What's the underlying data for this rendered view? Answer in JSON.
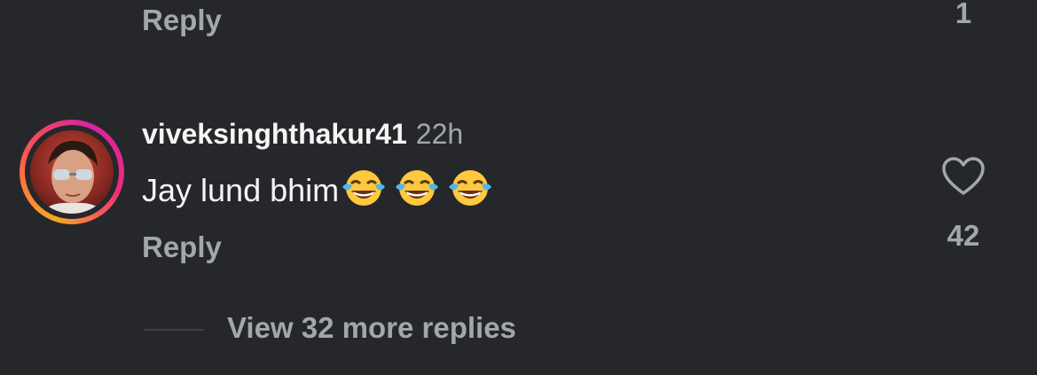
{
  "previous_comment": {
    "reply_label": "Reply",
    "like_count": "1"
  },
  "comment": {
    "username": "viveksinghthakur41",
    "timestamp": "22h",
    "text": "Jay lund bhim",
    "emojis": [
      "face-with-tears-of-joy",
      "face-with-tears-of-joy",
      "face-with-tears-of-joy"
    ],
    "reply_label": "Reply",
    "like_icon": "heart-outline-icon",
    "like_count": "42",
    "avatar_ring_colors": [
      "#f9a825",
      "#d6249f"
    ]
  },
  "view_more": {
    "label": "View 32 more replies"
  },
  "colors": {
    "background": "#26272b",
    "primary_text": "#f5f5f5",
    "secondary_text": "#a3a6ad"
  }
}
